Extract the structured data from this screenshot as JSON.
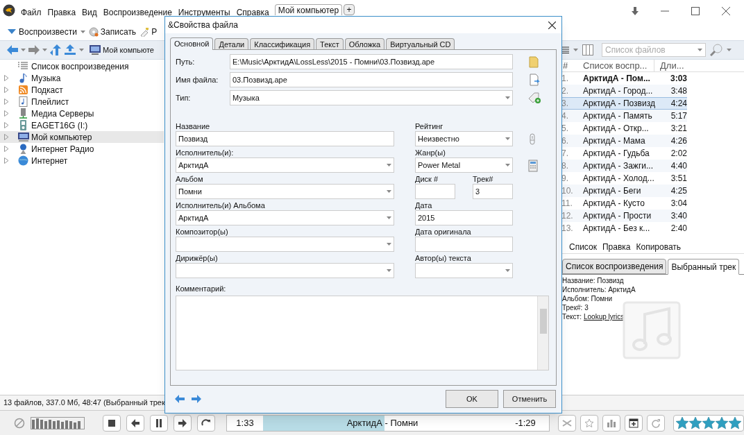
{
  "app": {
    "menu": [
      "Файл",
      "Правка",
      "Вид",
      "Воспроизведение",
      "Инструменты",
      "Справка"
    ],
    "tabs": [
      {
        "label": "Мой компьютер",
        "selected": true
      }
    ],
    "new_tab": "+"
  },
  "toolbar": [
    "Воспроизвести",
    "Записать",
    "Р"
  ],
  "nav": {
    "location": "Мой компьюте"
  },
  "search": {
    "placeholder": "Список файлов"
  },
  "tree": [
    {
      "label": "Список воспроизведения",
      "expandable": false,
      "selected": false
    },
    {
      "label": "Музыка",
      "expandable": true,
      "selected": false
    },
    {
      "label": "Подкаст",
      "expandable": true,
      "selected": false
    },
    {
      "label": "Плейлист",
      "expandable": true,
      "selected": false
    },
    {
      "label": "Медиа Серверы",
      "expandable": true,
      "selected": false
    },
    {
      "label": "EAGET16G (I:)",
      "expandable": true,
      "selected": false
    },
    {
      "label": "Мой компьютер",
      "expandable": true,
      "selected": true
    },
    {
      "label": "Интернет Радио",
      "expandable": true,
      "selected": false
    },
    {
      "label": "Интернет",
      "expandable": true,
      "selected": false
    }
  ],
  "playlist": {
    "columns": [
      "#",
      "Список воспр...",
      "Дли..."
    ],
    "rows": [
      {
        "number": "1.",
        "title": "АрктидА - Пом...",
        "duration": "3:03",
        "playing": true,
        "selected": false
      },
      {
        "number": "2.",
        "title": "АрктидА - Город...",
        "duration": "3:48",
        "playing": false,
        "selected": false
      },
      {
        "number": "3.",
        "title": "АрктидА - Позвизд",
        "duration": "4:24",
        "playing": false,
        "selected": true
      },
      {
        "number": "4.",
        "title": "АрктидА - Память",
        "duration": "5:17",
        "playing": false,
        "selected": false
      },
      {
        "number": "5.",
        "title": "АрктидА - Откр...",
        "duration": "3:21",
        "playing": false,
        "selected": false
      },
      {
        "number": "6.",
        "title": "АрктидА - Мама",
        "duration": "4:26",
        "playing": false,
        "selected": false
      },
      {
        "number": "7.",
        "title": "АрктидА - Гудьба",
        "duration": "2:02",
        "playing": false,
        "selected": false
      },
      {
        "number": "8.",
        "title": "АрктидА - Зажги...",
        "duration": "4:40",
        "playing": false,
        "selected": false
      },
      {
        "number": "9.",
        "title": "АрктидА - Холод...",
        "duration": "3:51",
        "playing": false,
        "selected": false
      },
      {
        "number": "10.",
        "title": "АрктидА - Беги",
        "duration": "4:25",
        "playing": false,
        "selected": false
      },
      {
        "number": "11.",
        "title": "АрктидА - Кусто",
        "duration": "3:04",
        "playing": false,
        "selected": false
      },
      {
        "number": "12.",
        "title": "АрктидА - Прости",
        "duration": "3:40",
        "playing": false,
        "selected": false
      },
      {
        "number": "13.",
        "title": "АрктидА - Без к...",
        "duration": "2:40",
        "playing": false,
        "selected": false
      }
    ]
  },
  "panel_menu": [
    "Список",
    "Правка",
    "Копировать"
  ],
  "panel_tabs": [
    {
      "label": "Список воспроизведения",
      "selected": false
    },
    {
      "label": "Выбранный трек",
      "selected": true
    }
  ],
  "track_info": [
    {
      "label": "Название:",
      "value": "Позвизд",
      "link": false
    },
    {
      "label": "Исполнитель:",
      "value": "АрктидА",
      "link": false
    },
    {
      "label": "Альбом:",
      "value": "Помни",
      "link": false
    },
    {
      "label": "Трек#:",
      "value": "3",
      "link": false
    },
    {
      "label": "Текст:",
      "value": "Lookup lyrics",
      "link": true
    }
  ],
  "status_bar": "13 файлов, 337.0 Мб, 48:47 (Выбранный трек",
  "player": {
    "elapsed": "1:33",
    "title": "АрктидА - Помни",
    "remaining": "-1:29",
    "level": 0.51,
    "stars": 5
  },
  "dialog": {
    "title": "&Свойства файла",
    "tabs": [
      {
        "label": "Основной",
        "selected": true
      },
      {
        "label": "Детали",
        "selected": false
      },
      {
        "label": "Классификация",
        "selected": false
      },
      {
        "label": "Текст",
        "selected": false
      },
      {
        "label": "Обложка",
        "selected": false
      },
      {
        "label": "Виртуальный CD",
        "selected": false
      }
    ],
    "top_fields": [
      {
        "label": "Путь:",
        "value": "E:\\Music\\АрктидА\\LossLess\\2015 - Помни\\03.Позвизд.ape",
        "kind": "text"
      },
      {
        "label": "Имя файла:",
        "value": "03.Позвизд.ape",
        "kind": "text"
      },
      {
        "label": "Тип:",
        "value": "Музыка",
        "kind": "combo"
      }
    ],
    "left_fields": [
      {
        "label": "Название",
        "value": "Позвизд",
        "kind": "text"
      },
      {
        "label": "Исполнитель(и):",
        "value": "АрктидА",
        "kind": "combo"
      },
      {
        "label": "Альбом",
        "value": "Помни",
        "kind": "combo"
      },
      {
        "label": "Исполнитель(и) Альбома",
        "value": "АрктидА",
        "kind": "combo"
      },
      {
        "label": "Композитор(ы)",
        "kind": "combo"
      },
      {
        "label": "Дирижёр(ы)",
        "kind": "combo"
      }
    ],
    "right_rows": [
      {
        "fields": [
          {
            "label": "Рейтинг",
            "value": "Неизвестно",
            "kind": "combo"
          }
        ]
      },
      {
        "fields": [
          {
            "label": "Жанр(ы)",
            "value": "Power Metal",
            "kind": "combo"
          }
        ]
      },
      {
        "fields": [
          {
            "label": "Диск #",
            "kind": "text"
          },
          {
            "label": "Трек#",
            "value": "3",
            "kind": "text"
          }
        ]
      },
      {
        "fields": [
          {
            "label": "Дата",
            "value": "2015",
            "kind": "text"
          }
        ]
      },
      {
        "fields": [
          {
            "label": "Дата оригинала",
            "kind": "text"
          }
        ]
      },
      {
        "fields": [
          {
            "label": "Автор(ы) текста",
            "kind": "combo"
          }
        ]
      }
    ],
    "comment": {
      "label": "Комментарий:"
    },
    "buttons": [
      "OK",
      "Отменить"
    ]
  }
}
